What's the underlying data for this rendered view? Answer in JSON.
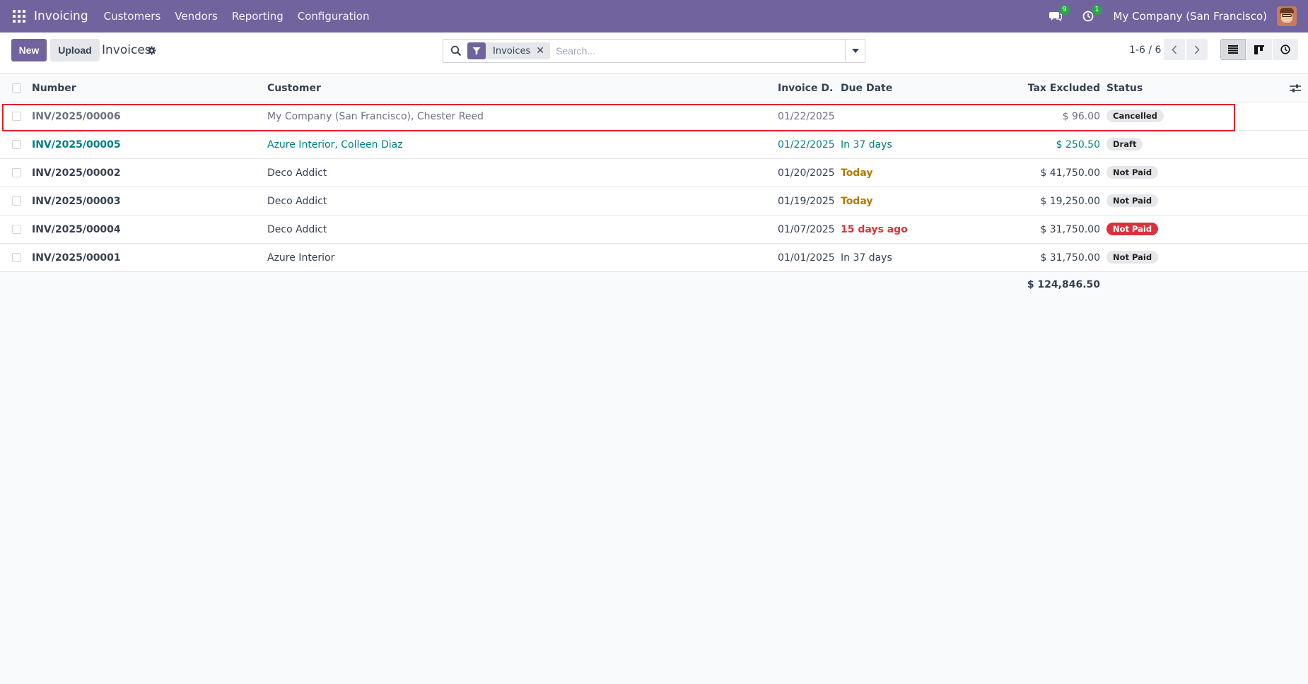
{
  "topbar": {
    "app_name": "Invoicing",
    "menu": [
      "Customers",
      "Vendors",
      "Reporting",
      "Configuration"
    ],
    "messages_count": "9",
    "activities_count": "1",
    "company": "My Company (San Francisco)"
  },
  "control": {
    "new_label": "New",
    "upload_label": "Upload",
    "title": "Invoices",
    "facet_label": "Invoices",
    "search_placeholder": "Search...",
    "pager": "1-6 / 6"
  },
  "table": {
    "headers": {
      "number": "Number",
      "customer": "Customer",
      "invoice_date": "Invoice D...",
      "due_date": "Due Date",
      "tax_excluded": "Tax Excluded",
      "status": "Status"
    },
    "rows": [
      {
        "number": "INV/2025/00006",
        "customer": "My Company (San Francisco), Chester Reed",
        "invoice_date": "01/22/2025",
        "due_date": "",
        "tax_excluded": "$ 96.00",
        "status": "Cancelled"
      },
      {
        "number": "INV/2025/00005",
        "customer": "Azure Interior, Colleen Diaz",
        "invoice_date": "01/22/2025",
        "due_date": "In 37 days",
        "tax_excluded": "$ 250.50",
        "status": "Draft"
      },
      {
        "number": "INV/2025/00002",
        "customer": "Deco Addict",
        "invoice_date": "01/20/2025",
        "due_date": "Today",
        "tax_excluded": "$ 41,750.00",
        "status": "Not Paid"
      },
      {
        "number": "INV/2025/00003",
        "customer": "Deco Addict",
        "invoice_date": "01/19/2025",
        "due_date": "Today",
        "tax_excluded": "$ 19,250.00",
        "status": "Not Paid"
      },
      {
        "number": "INV/2025/00004",
        "customer": "Deco Addict",
        "invoice_date": "01/07/2025",
        "due_date": "15 days ago",
        "tax_excluded": "$ 31,750.00",
        "status": "Not Paid"
      },
      {
        "number": "INV/2025/00001",
        "customer": "Azure Interior",
        "invoice_date": "01/01/2025",
        "due_date": "In 37 days",
        "tax_excluded": "$ 31,750.00",
        "status": "Not Paid"
      }
    ],
    "total": "$ 124,846.50"
  },
  "colors": {
    "brand": "#71639e",
    "link": "#017e84",
    "warning": "#b27b00",
    "danger": "#d9323d",
    "highlight": "#e0202a"
  },
  "icons": [
    "apps-grid-icon",
    "chat-icon",
    "clock-icon",
    "gear-icon",
    "search-icon",
    "filter-icon",
    "close-icon",
    "caret-down-icon",
    "chevron-left-icon",
    "chevron-right-icon",
    "list-view-icon",
    "kanban-view-icon",
    "activity-view-icon",
    "adjust-columns-icon"
  ]
}
